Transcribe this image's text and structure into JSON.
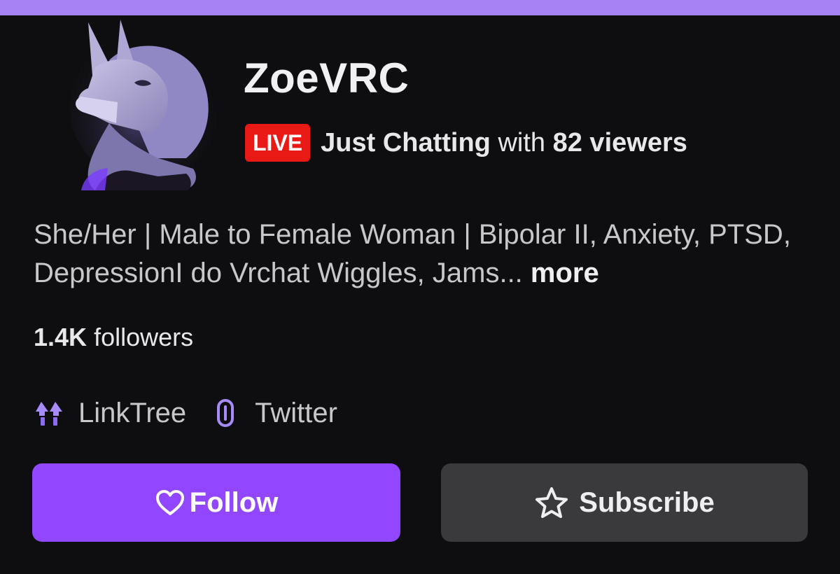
{
  "channel": {
    "name": "ZoeVRC",
    "avatar_alt": "wolf avatar illustration"
  },
  "live": {
    "badge": "LIVE",
    "category": "Just Chatting",
    "with_text": "with",
    "viewers": "82 viewers"
  },
  "bio": {
    "text": "She/Her | Male to Female Woman | Bipolar II, Anxiety, PTSD, DepressionI do Vrchat Wiggles, Jams...",
    "more_label": "more"
  },
  "followers": {
    "count": "1.4K",
    "label": "followers"
  },
  "links": [
    {
      "label": "LinkTree",
      "icon": "linktree-icon"
    },
    {
      "label": "Twitter",
      "icon": "link-chain-icon"
    }
  ],
  "buttons": {
    "follow_label": "Follow",
    "subscribe_label": "Subscribe"
  },
  "colors": {
    "accent": "#9147ff",
    "top_bar": "#a782f5",
    "live_red": "#e91916",
    "background": "#0e0e10",
    "secondary_button": "#3a3a3d"
  }
}
